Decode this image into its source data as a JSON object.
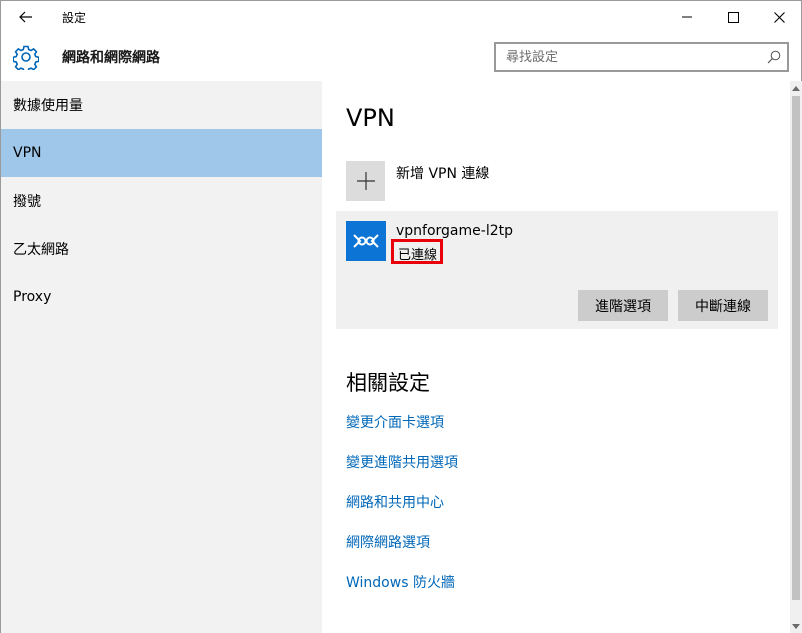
{
  "window": {
    "title": "設定"
  },
  "header": {
    "title": "網路和網際網路",
    "search_placeholder": "尋找設定"
  },
  "sidebar": {
    "items": [
      {
        "label": "數據使用量",
        "active": false
      },
      {
        "label": "VPN",
        "active": true
      },
      {
        "label": "撥號",
        "active": false
      },
      {
        "label": "乙太網路",
        "active": false
      },
      {
        "label": "Proxy",
        "active": false
      }
    ]
  },
  "main": {
    "page_title": "VPN",
    "add_vpn_label": "新增 VPN 連線",
    "connection": {
      "name": "vpnforgame-l2tp",
      "status": "已連線",
      "advanced_button": "進階選項",
      "disconnect_button": "中斷連線"
    },
    "related_title": "相關設定",
    "related_links": [
      "變更介面卡選項",
      "變更進階共用選項",
      "網路和共用中心",
      "網際網路選項",
      "Windows 防火牆"
    ]
  },
  "colors": {
    "accent": "#0067b8",
    "nav_active": "#9fc7ea",
    "vpn_icon_bg": "#0b74d5",
    "highlight_border": "#e8000b"
  }
}
